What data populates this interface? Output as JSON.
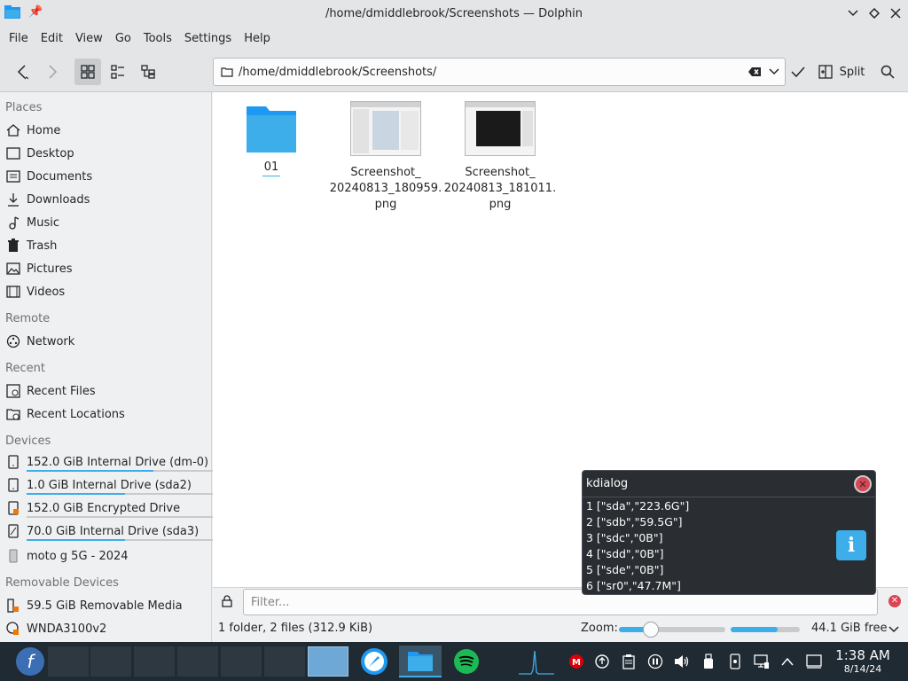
{
  "window": {
    "title": "/home/dmiddlebrook/Screenshots — Dolphin",
    "pin_icon": "pin-icon",
    "controls": [
      "minimize",
      "maximize",
      "close"
    ]
  },
  "menu": [
    "File",
    "Edit",
    "View",
    "Go",
    "Tools",
    "Settings",
    "Help"
  ],
  "toolbar": {
    "address": "/home/dmiddlebrook/Screenshots/",
    "split_label": "Split"
  },
  "sidebar": {
    "places_header": "Places",
    "places": [
      {
        "label": "Home",
        "icon": "home-icon"
      },
      {
        "label": "Desktop",
        "icon": "desktop-icon"
      },
      {
        "label": "Documents",
        "icon": "documents-icon"
      },
      {
        "label": "Downloads",
        "icon": "downloads-icon"
      },
      {
        "label": "Music",
        "icon": "music-icon"
      },
      {
        "label": "Trash",
        "icon": "trash-icon"
      },
      {
        "label": "Pictures",
        "icon": "pictures-icon"
      },
      {
        "label": "Videos",
        "icon": "videos-icon"
      }
    ],
    "remote_header": "Remote",
    "remote": [
      {
        "label": "Network",
        "icon": "network-icon"
      }
    ],
    "recent_header": "Recent",
    "recent": [
      {
        "label": "Recent Files",
        "icon": "recent-files-icon"
      },
      {
        "label": "Recent Locations",
        "icon": "recent-locations-icon"
      }
    ],
    "devices_header": "Devices",
    "devices": [
      {
        "label": "152.0 GiB Internal Drive (dm-0)",
        "usage": 0.68
      },
      {
        "label": "1.0 GiB Internal Drive (sda2)",
        "usage": 0.53
      },
      {
        "label": "152.0 GiB Encrypted Drive",
        "usage": 0.0
      },
      {
        "label": "70.0 GiB Internal Drive (sda3)",
        "usage": 0.53
      }
    ],
    "phone": {
      "label": "moto g 5G - 2024"
    },
    "removable_header": "Removable Devices",
    "removable": [
      {
        "label": "59.5 GiB Removable Media"
      },
      {
        "label": "WNDA3100v2"
      }
    ]
  },
  "files": [
    {
      "name": "01",
      "type": "folder"
    },
    {
      "name_line1": "Screenshot_",
      "name_line2": "20240813_180959.",
      "name_line3": "png",
      "type": "image"
    },
    {
      "name_line1": "Screenshot_",
      "name_line2": "20240813_181011.",
      "name_line3": "png",
      "type": "image"
    }
  ],
  "filter": {
    "placeholder": "Filter..."
  },
  "status": {
    "summary": "1 folder, 2 files (312.9 KiB)",
    "zoom_label": "Zoom:",
    "zoom_level": 0.3,
    "free_fraction": 0.68,
    "free_label": "44.1 GiB free"
  },
  "dialog": {
    "title": "kdialog",
    "lines": [
      "1 [\"sda\",\"223.6G\"]",
      "2 [\"sdb\",\"59.5G\"]",
      "3 [\"sdc\",\"0B\"]",
      "4 [\"sdd\",\"0B\"]",
      "5 [\"sde\",\"0B\"]",
      "6 [\"sr0\",\"47.7M\"]"
    ],
    "info_icon": "info-icon"
  },
  "taskbar": {
    "time": "1:38 AM",
    "date": "8/14/24"
  }
}
